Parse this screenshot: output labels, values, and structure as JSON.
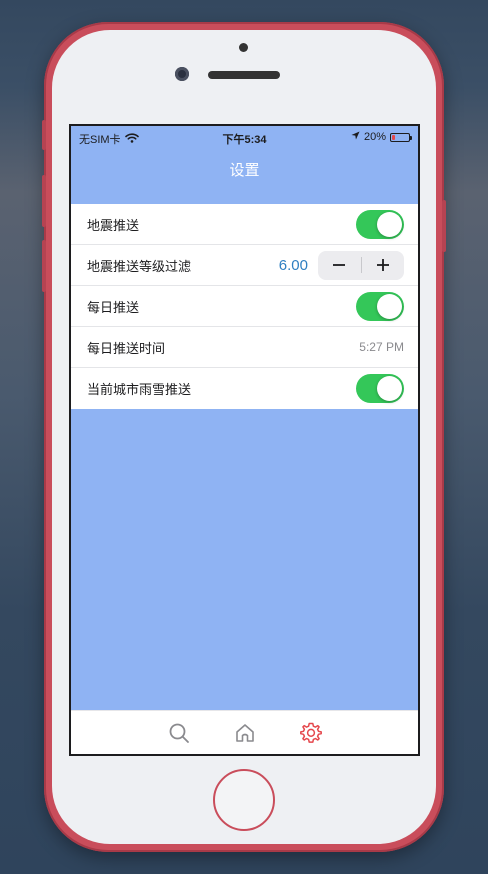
{
  "colors": {
    "accent_blue": "#8fb3f3",
    "toggle_green": "#34c759",
    "stepper_value_blue": "#2f7fc1",
    "tab_active_red": "#e5484d",
    "tab_inactive_gray": "#8a8a8e"
  },
  "status_bar": {
    "carrier": "无SIM卡",
    "wifi_icon": "wifi-icon",
    "time": "下午5:34",
    "location_icon": "location-arrow-icon",
    "battery_percent": "20%",
    "battery_level": 0.2
  },
  "nav": {
    "title": "设置"
  },
  "settings": {
    "earthquake_push": {
      "label": "地震推送",
      "on": true
    },
    "earthquake_level_filter": {
      "label": "地震推送等级过滤",
      "value": "6.00",
      "minus": "−",
      "plus": "+"
    },
    "daily_push": {
      "label": "每日推送",
      "on": true
    },
    "daily_push_time": {
      "label": "每日推送时间",
      "value": "5:27 PM"
    },
    "city_weather_push": {
      "label": "当前城市雨雪推送",
      "on": true
    }
  },
  "tab_bar": {
    "items": [
      {
        "icon": "search-icon",
        "active": false
      },
      {
        "icon": "home-icon",
        "active": false
      },
      {
        "icon": "gear-icon",
        "active": true
      }
    ]
  }
}
